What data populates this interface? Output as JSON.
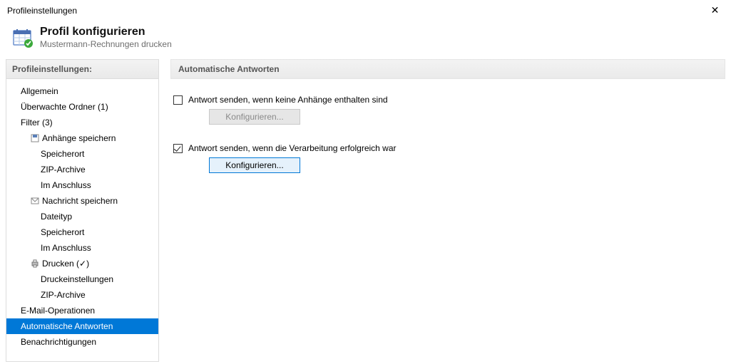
{
  "window": {
    "title": "Profileinstellungen",
    "close_glyph": "✕"
  },
  "header": {
    "title": "Profil konfigurieren",
    "subtitle": "Mustermann-Rechnungen drucken"
  },
  "sidebar": {
    "section_title": "Profileinstellungen:",
    "items": {
      "allgemein": "Allgemein",
      "ueberwachte_ordner": "Überwachte Ordner (1)",
      "filter": "Filter (3)",
      "anhaenge_speichern": "Anhänge speichern",
      "anhaenge_speicherort": "Speicherort",
      "anhaenge_zip": "ZIP-Archive",
      "anhaenge_im_anschluss": "Im Anschluss",
      "nachricht_speichern": "Nachricht speichern",
      "nachricht_dateityp": "Dateityp",
      "nachricht_speicherort": "Speicherort",
      "nachricht_im_anschluss": "Im Anschluss",
      "drucken": "Drucken (✓)",
      "druckeinstellungen": "Druckeinstellungen",
      "drucken_zip": "ZIP-Archive",
      "email_operationen": "E-Mail-Operationen",
      "automatische_antworten": "Automatische Antworten",
      "benachrichtigungen": "Benachrichtigungen"
    }
  },
  "main": {
    "section_title": "Automatische Antworten",
    "option1": {
      "checked": false,
      "label": "Antwort senden, wenn keine Anhänge enthalten sind",
      "button": "Konfigurieren..."
    },
    "option2": {
      "checked": true,
      "label": "Antwort senden, wenn die Verarbeitung erfolgreich war",
      "button": "Konfigurieren..."
    }
  }
}
